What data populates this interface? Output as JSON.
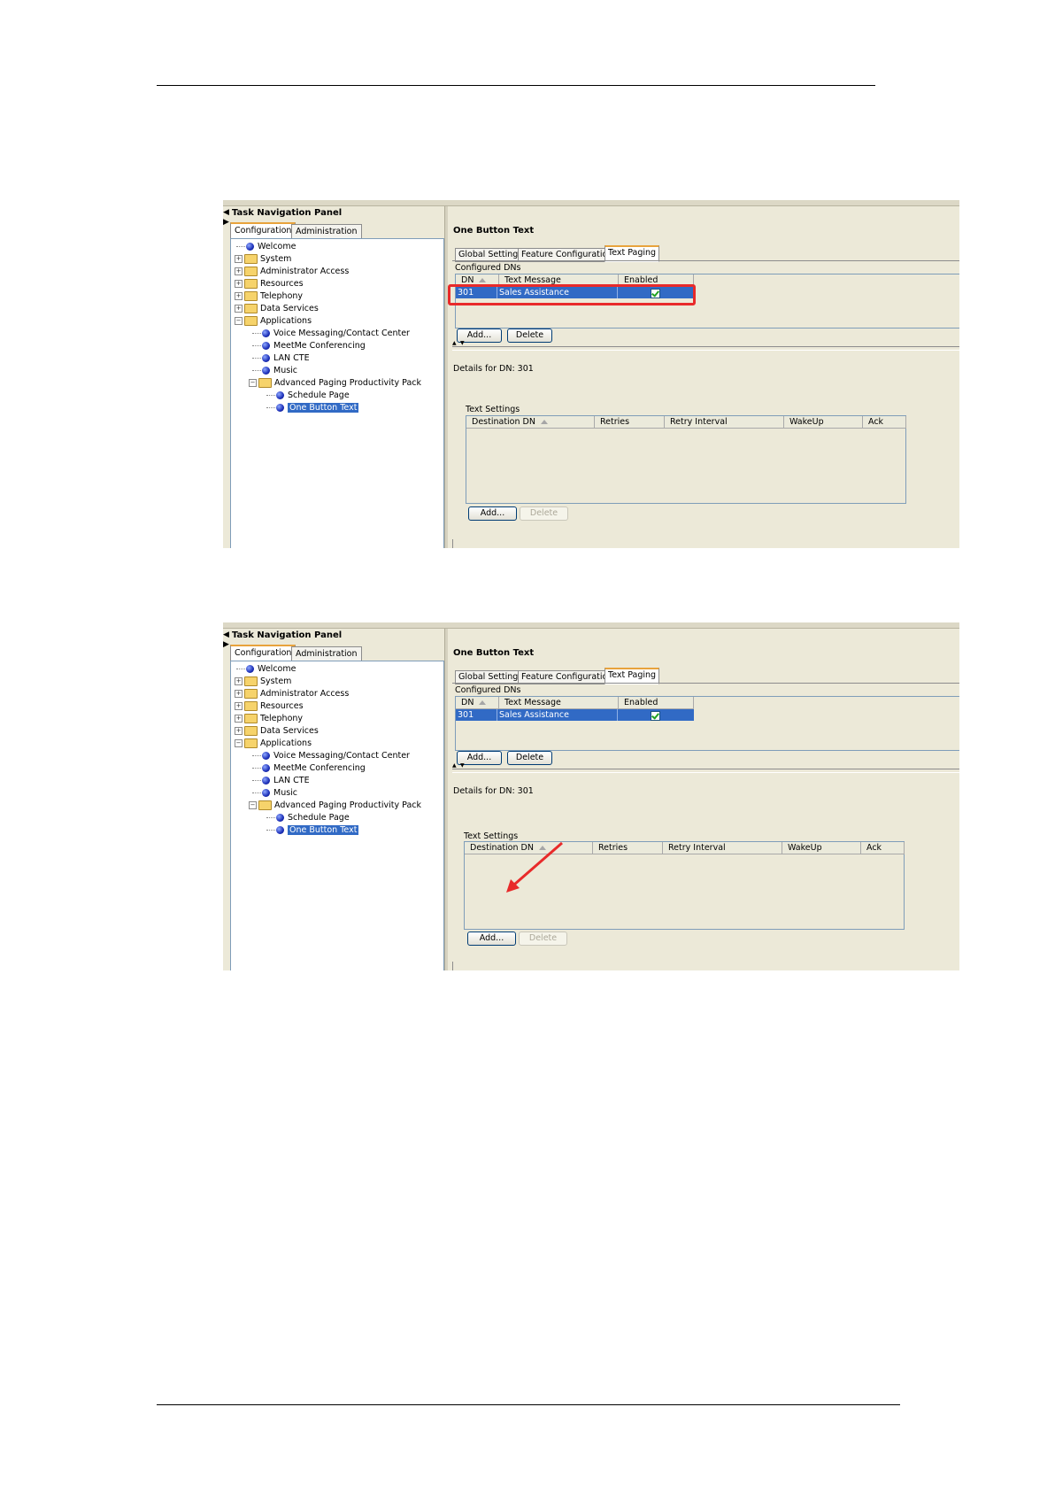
{
  "nav": {
    "title": "Task Navigation Panel",
    "tabs": [
      "Configuration",
      "Administration"
    ],
    "tree": [
      {
        "label": "Welcome"
      },
      {
        "label": "System"
      },
      {
        "label": "Administrator Access"
      },
      {
        "label": "Resources"
      },
      {
        "label": "Telephony"
      },
      {
        "label": "Data Services"
      },
      {
        "label": "Applications"
      },
      {
        "label": "Voice Messaging/Contact Center"
      },
      {
        "label": "MeetMe Conferencing"
      },
      {
        "label": "LAN CTE"
      },
      {
        "label": "Music"
      },
      {
        "label": "Advanced Paging Productivity Pack"
      },
      {
        "label": "Schedule Page"
      },
      {
        "label": "One Button Text"
      }
    ]
  },
  "main": {
    "title": "One Button Text",
    "tabs": [
      "Global Settings",
      "Feature Configuration",
      "Text Paging"
    ],
    "configured_dns_label": "Configured DNs",
    "dn_columns": [
      "DN",
      "Text Message",
      "Enabled"
    ],
    "dn_row": {
      "dn": "301",
      "enabled": true
    },
    "dn_row_message_1": "Sales Assistance",
    "dn_row_message_2": "Sales Assistance",
    "add_label": "Add...",
    "delete_label": "Delete",
    "details_label": "Details for DN: 301",
    "text_settings_label": "Text Settings",
    "ts_columns": [
      "Destination DN",
      "Retries",
      "Retry Interval",
      "WakeUp",
      "Ack"
    ],
    "ts_add_label": "Add...",
    "ts_delete_label": "Delete"
  },
  "colors": {
    "highlight_box": "#e82a2a",
    "arrow": "#e82a2a",
    "selection": "#316ac5"
  }
}
